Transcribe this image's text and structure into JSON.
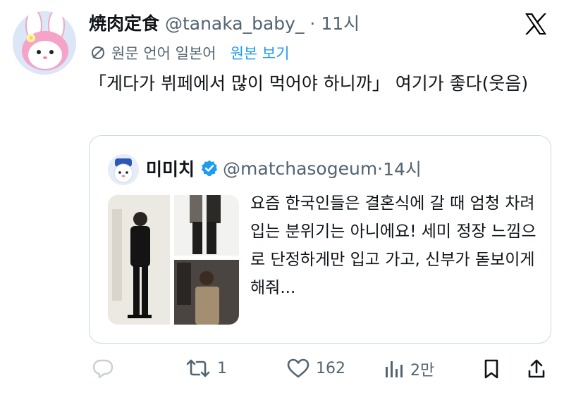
{
  "tweet": {
    "display_name": "焼肉定食",
    "handle": "@tanaka_baby_",
    "time_sep": " · ",
    "time": "11시",
    "translation_note": "원문 언어 일본어",
    "view_original": "원본 보기",
    "text": "「게다가 뷔페에서 많이 먹어야 하니까」 여기가 좋다(웃음)"
  },
  "quoted": {
    "display_name": "미미치",
    "handle": "@matchasogeum",
    "time_sep": " · ",
    "time": "14시",
    "text": "요즘 한국인들은 결혼식에 갈 때 엄청 차려입는 분위기는 아니에요! 세미 정장 느낌으로 단정하게만 입고 가고, 신부가 돋보이게 해줘..."
  },
  "actions": {
    "reply_count": "",
    "retweet_count": "1",
    "like_count": "162",
    "views_count": "2만"
  },
  "colors": {
    "accent": "#1d9bf0",
    "secondary_text": "#536471",
    "border": "#cfd9de"
  }
}
